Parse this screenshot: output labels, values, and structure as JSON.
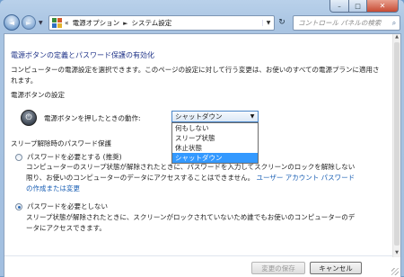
{
  "window": {
    "minimize_glyph": "–",
    "maximize_glyph": "□",
    "close_glyph": "✕"
  },
  "nav": {
    "back_glyph": "◄",
    "forward_glyph": "►",
    "recent_glyph": "▼",
    "breadcrumb_prefix": "«",
    "breadcrumb": [
      "電源オプション",
      "システム設定"
    ],
    "separator": "►",
    "refresh_glyph": "↻",
    "search_placeholder": "コントロール パネルの検索",
    "search_icon": "search-icon"
  },
  "main": {
    "heading": "電源ボタンの定義とパスワード保護の有効化",
    "intro": "コンピューターの電源設定を選択できます。このページの設定に対して行う変更は、お使いのすべての電源プランに適用されます。",
    "power_section_title": "電源ボタンの設定",
    "power_button_label": "電源ボタンを押したときの動作:",
    "power_action_selected": "シャットダウン",
    "power_action_options": [
      "何もしない",
      "スリープ状態",
      "休止状態",
      "シャットダウン"
    ],
    "wake_section_title": "スリープ解除時のパスワード保護",
    "radio_require": "パスワードを必要とする (推奨)",
    "radio_require_desc": "コンピューターのスリープ状態が解除されたときに、パスワードを入力してスクリーンのロックを解除しない限り、お使いのコンピューターのデータにアクセスすることはできません。",
    "link_text": "ユーザー アカウント パスワードの作成または変更",
    "radio_no_require": "パスワードを必要としない",
    "radio_no_require_desc": "スリープ状態が解除されたときに、スクリーンがロックされていないため誰でもお使いのコンピューターのデータにアクセスできます。",
    "selected_radio": "no_require"
  },
  "footer": {
    "save_label": "変更の保存",
    "cancel_label": "キャンセル"
  },
  "colors": {
    "heading": "#1e3287",
    "link": "#1a5fb4",
    "selection": "#3399ff"
  }
}
